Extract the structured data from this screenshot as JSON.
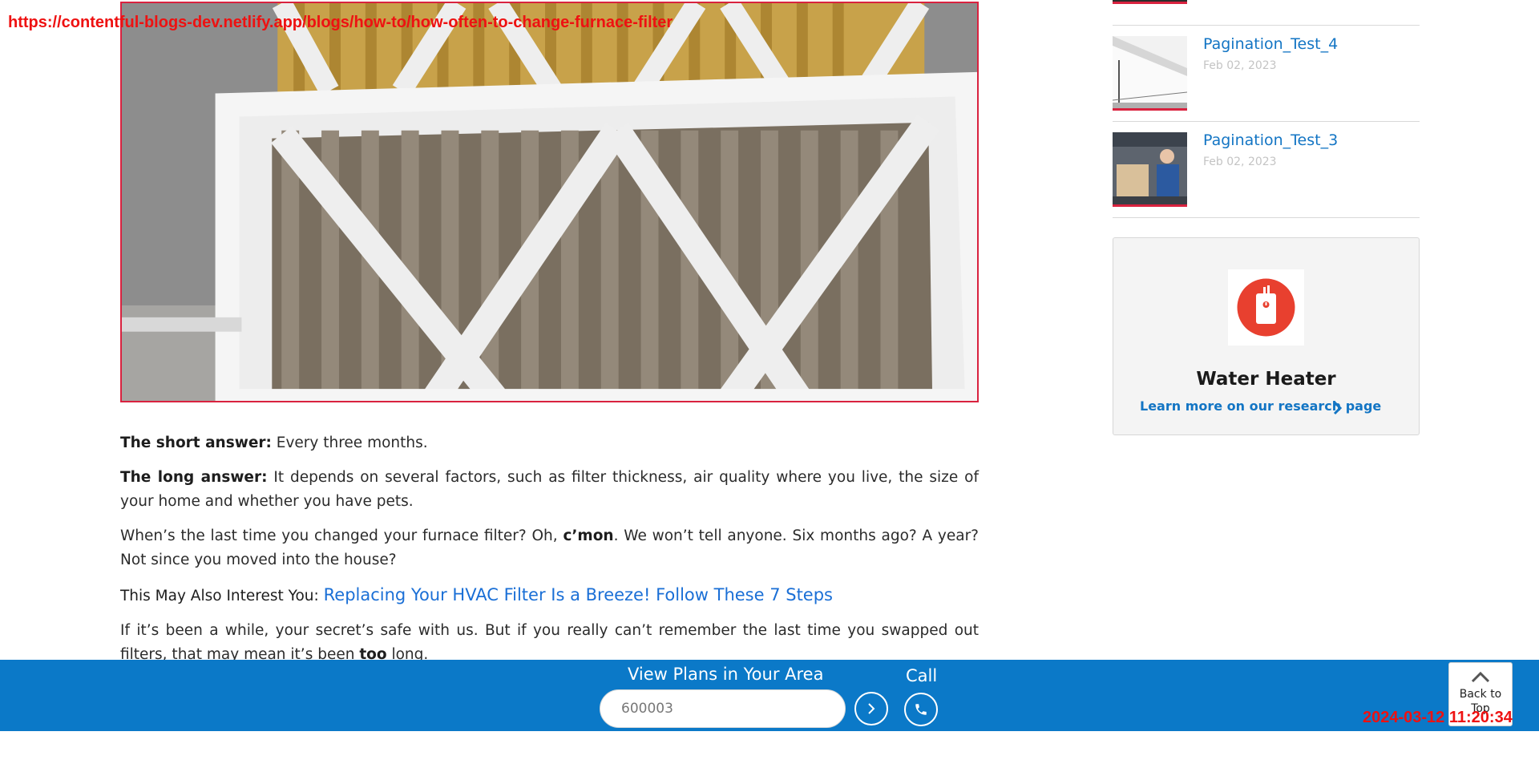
{
  "page": {
    "url_overlay": "https://contentful-blogs-dev.netlify.app/blogs/how-to/how-often-to-change-furnace-filter",
    "timestamp": "2024-03-12 11:20:34"
  },
  "article": {
    "short_answer_label": "The short answer:",
    "short_answer_text": " Every three months.",
    "long_answer_label": "The long answer:",
    "long_answer_text": " It depends on several factors, such as filter thickness, air quality where you live, the size of your home and whether you have pets.",
    "p3_before": "When’s the last time you changed your furnace filter? Oh, ",
    "p3_bold": "c’mon",
    "p3_after": ". We won’t tell anyone. Six months ago? A year? Not since you moved into the house?",
    "interest_label": "This May Also Interest You: ",
    "interest_link": "Replacing Your HVAC Filter Is a Breeze! Follow These 7 Steps",
    "p5_before": "If it’s been a while, your secret’s safe with us. But if you really can’t remember the last time you swapped out filters, that may mean it’s been ",
    "p5_bold": "too",
    "p5_after": " long."
  },
  "sidebar": {
    "recent_posts": [
      {
        "title": "Pagination_Test_4",
        "date": "Feb 02, 2023"
      },
      {
        "title": "Pagination_Test_3",
        "date": "Feb 02, 2023"
      }
    ],
    "promo": {
      "icon": "water-heater-icon",
      "title": "Water Heater",
      "link": "Learn more on our research page"
    }
  },
  "bottom_bar": {
    "heading": "View Plans in Your Area",
    "zip_value": "600003",
    "call_label": "Call"
  },
  "back_to_top": {
    "label": "Back to Top"
  },
  "colors": {
    "accent_blue": "#0b79c8",
    "link_blue": "#1375c4",
    "brand_red": "#d9223f"
  }
}
